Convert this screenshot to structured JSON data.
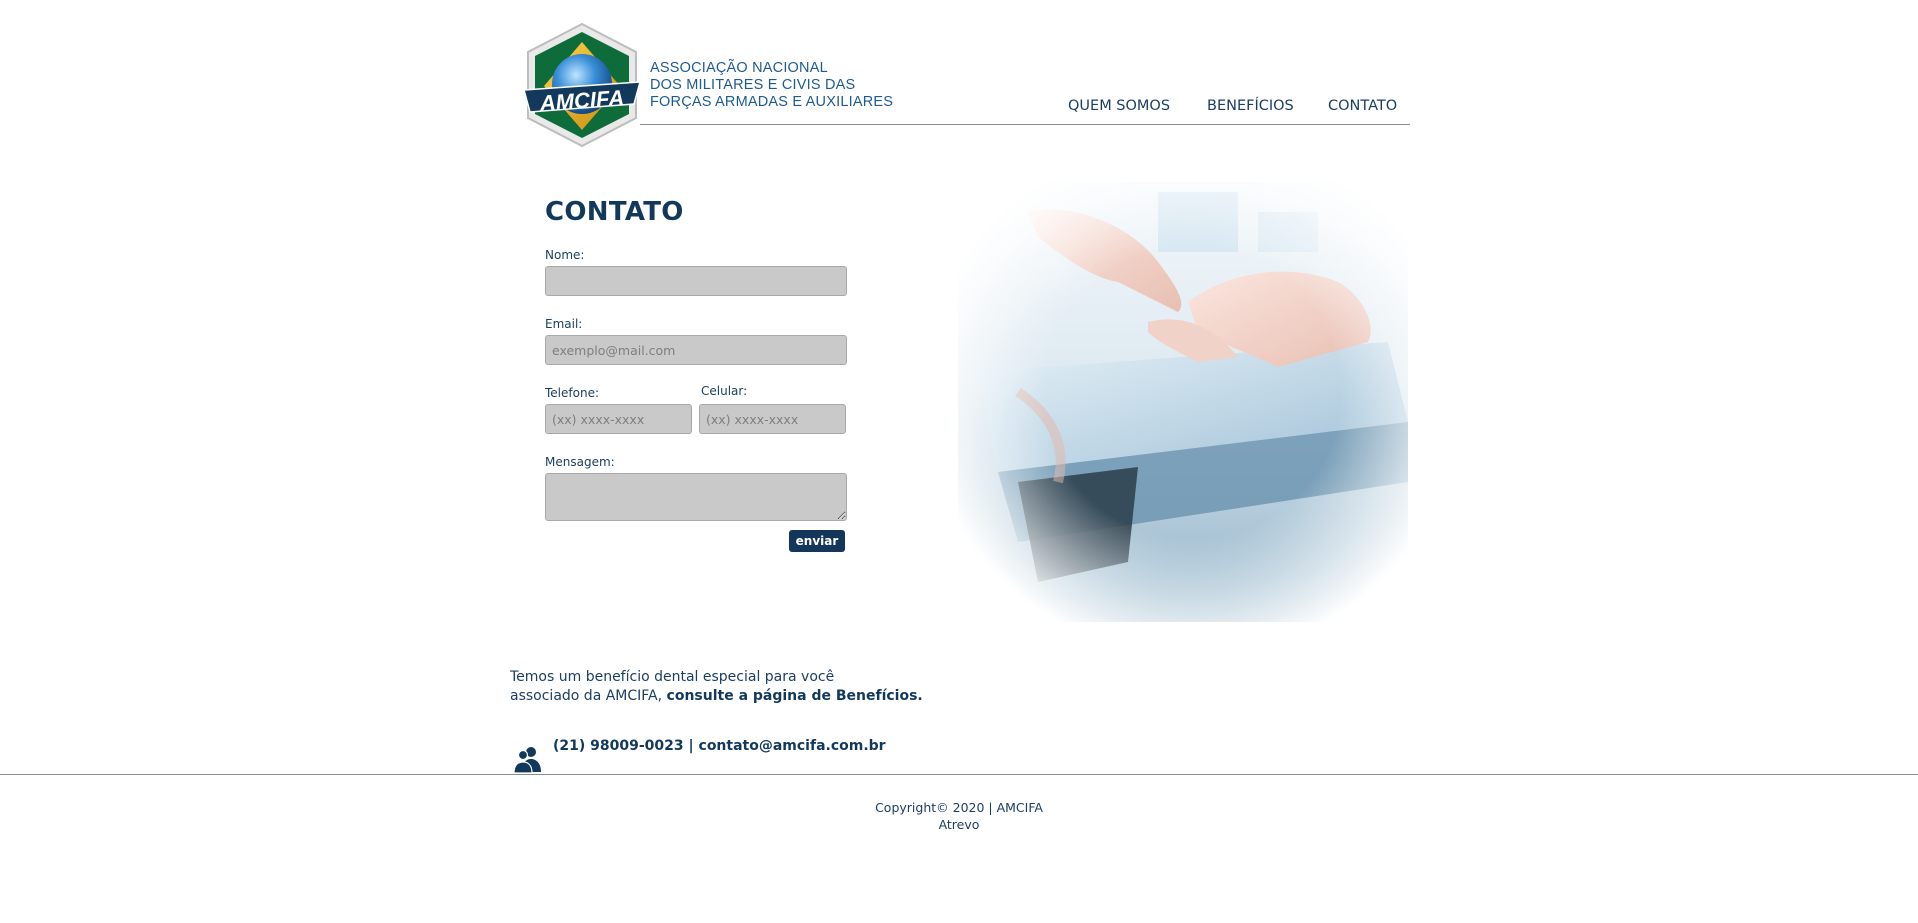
{
  "brand": {
    "logo_text": "AMCIFA",
    "name_lines": [
      "ASSOCIAÇÃO NACIONAL",
      "DOS MILITARES E CIVIS DAS",
      "FORÇAS ARMADAS E AUXILIARES"
    ],
    "colors": {
      "primary": "#12395c",
      "green": "#0e6b3a",
      "yellow": "#f2b21b",
      "blue": "#1f73c4"
    }
  },
  "nav": {
    "items": [
      {
        "label": "QUEM SOMOS"
      },
      {
        "label": "BENEFÍCIOS"
      },
      {
        "label": "CONTATO"
      }
    ]
  },
  "form": {
    "title": "CONTATO",
    "name_label": "Nome:",
    "name_value": "",
    "email_label": "Email:",
    "email_placeholder": "exemplo@mail.com",
    "phone_label": "Telefone:",
    "phone_placeholder": "(xx) xxxx-xxxx",
    "mobile_label": "Celular:",
    "mobile_placeholder": "(xx) xxxx-xxxx",
    "message_label": "Mensagem:",
    "submit_label": "enviar"
  },
  "promo": {
    "line1": "Temos um benefício dental especial para você",
    "line2_prefix": "associado da AMCIFA,",
    "line2_link": "consulte a página de Benefícios."
  },
  "contact": {
    "phone": "(21) 98009-0023",
    "separator": "|",
    "email": "contato@amcifa.com.br"
  },
  "footer": {
    "copyright": "Copyright© 2020 | AMCIFA",
    "credit": "Atrevo"
  }
}
